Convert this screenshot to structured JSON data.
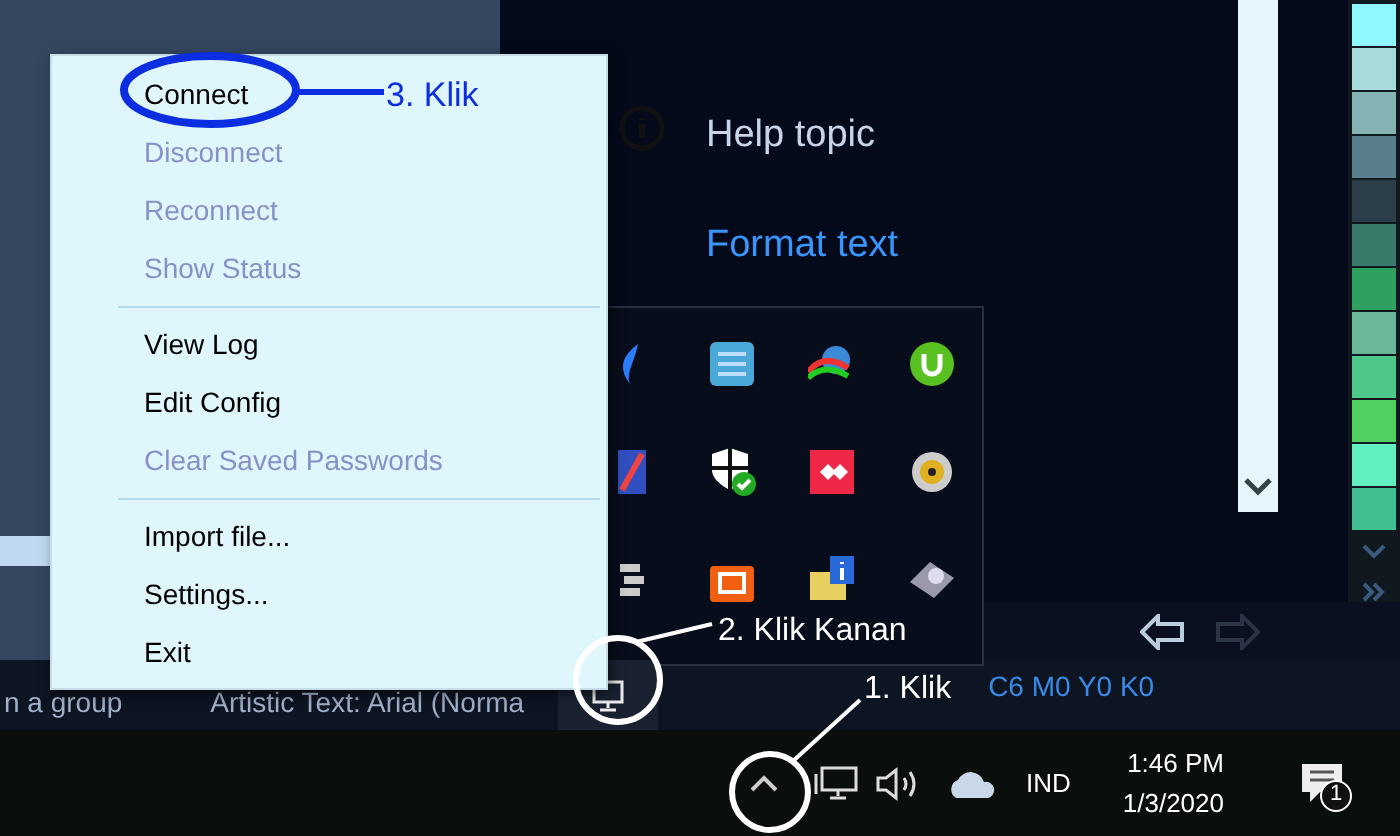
{
  "menu": {
    "groups": [
      [
        {
          "label": "Connect",
          "disabled": false
        },
        {
          "label": "Disconnect",
          "disabled": true
        },
        {
          "label": "Reconnect",
          "disabled": true
        },
        {
          "label": "Show Status",
          "disabled": true
        }
      ],
      [
        {
          "label": "View Log",
          "disabled": false
        },
        {
          "label": "Edit Config",
          "disabled": false
        },
        {
          "label": "Clear Saved Passwords",
          "disabled": true
        }
      ],
      [
        {
          "label": "Import file...",
          "disabled": false
        },
        {
          "label": "Settings...",
          "disabled": false
        },
        {
          "label": "Exit",
          "disabled": false
        }
      ]
    ]
  },
  "help": {
    "items": [
      {
        "label": "Help topic",
        "kind": "topic"
      },
      {
        "label": "Format text",
        "kind": "link"
      }
    ]
  },
  "palette": {
    "swatches": [
      {
        "color": "#8ff8ff"
      },
      {
        "color": "#a8dcdc"
      },
      {
        "color": "#86b4b4"
      },
      {
        "color": "#5a7f8c"
      },
      {
        "color": "#2c3e4a"
      },
      {
        "color": "#3a7a6a"
      },
      {
        "color": "#30a060"
      },
      {
        "color": "#6ab898"
      },
      {
        "color": "#4ec88a"
      },
      {
        "color": "#50d060"
      },
      {
        "color": "#60f0c0"
      },
      {
        "color": "#40c090"
      }
    ]
  },
  "status_bar": {
    "items": [
      "n a group",
      "Artistic Text: Arial (Norma"
    ],
    "color_readout": "C6 M0 Y0 K0"
  },
  "taskbar": {
    "language": "IND",
    "time": "1:46 PM",
    "date": "1/3/2020",
    "notification_count": "1"
  },
  "annotations": {
    "step_3": "3. Klik",
    "step_2": "2. Klik Kanan",
    "step_1": "1. Klik"
  }
}
